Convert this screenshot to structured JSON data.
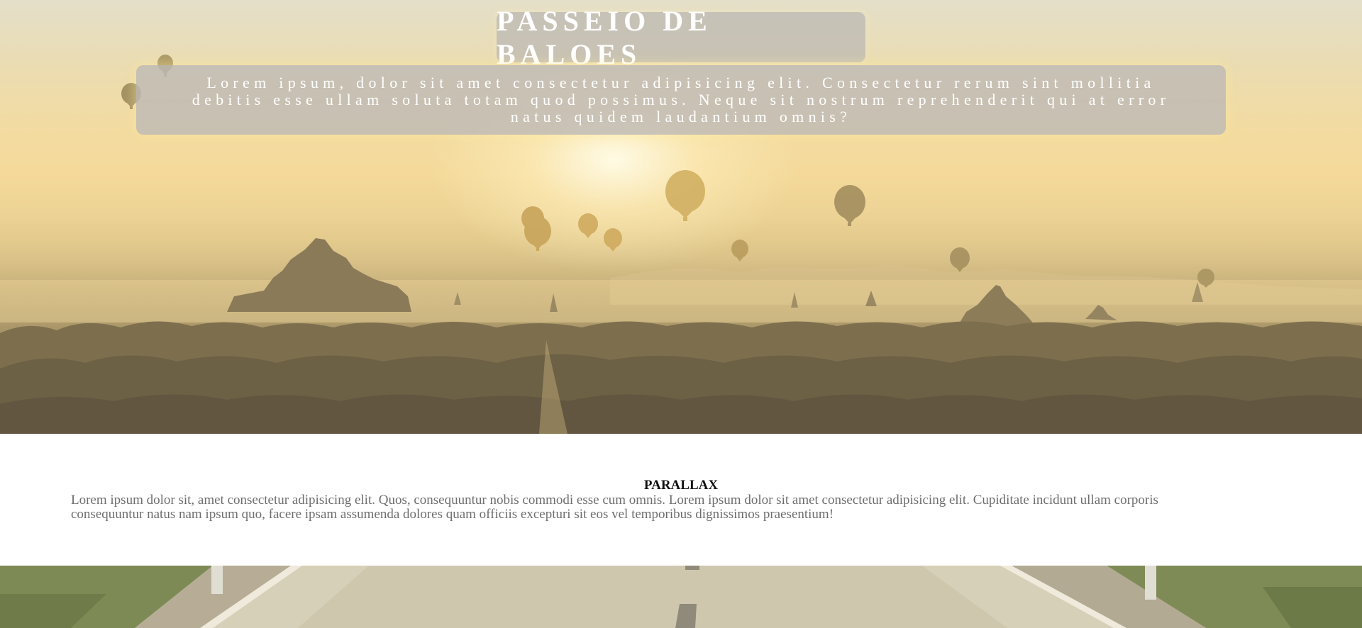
{
  "hero": {
    "title": "PASSEIO DE BALOES",
    "subtitle": "Lorem ipsum, dolor sit amet consectetur adipisicing elit. Consectetur rerum sint mollitia debitis esse ullam soluta totam quod possimus. Neque sit nostrum reprehenderit qui at error natus quidem laudantium omnis?"
  },
  "parallax": {
    "heading": "PARALLAX",
    "body": "Lorem ipsum dolor sit, amet consectetur adipisicing elit. Quos, consequuntur nobis commodi esse cum omnis. Lorem ipsum dolor sit amet consectetur adipisicing elit. Cupiditate incidunt ullam corporis consequuntur natus nam ipsum quo, facere ipsam assumenda dolores quam officiis excepturi sit eos vel temporibus dignissimos praesentium!"
  },
  "colors": {
    "overlay_box": "#bebab4",
    "heading_text": "#111111",
    "body_text": "#6e6e6e"
  },
  "icons": {
    "hero_image": "hot-air-balloons-landscape",
    "footer_image": "road-landscape"
  }
}
